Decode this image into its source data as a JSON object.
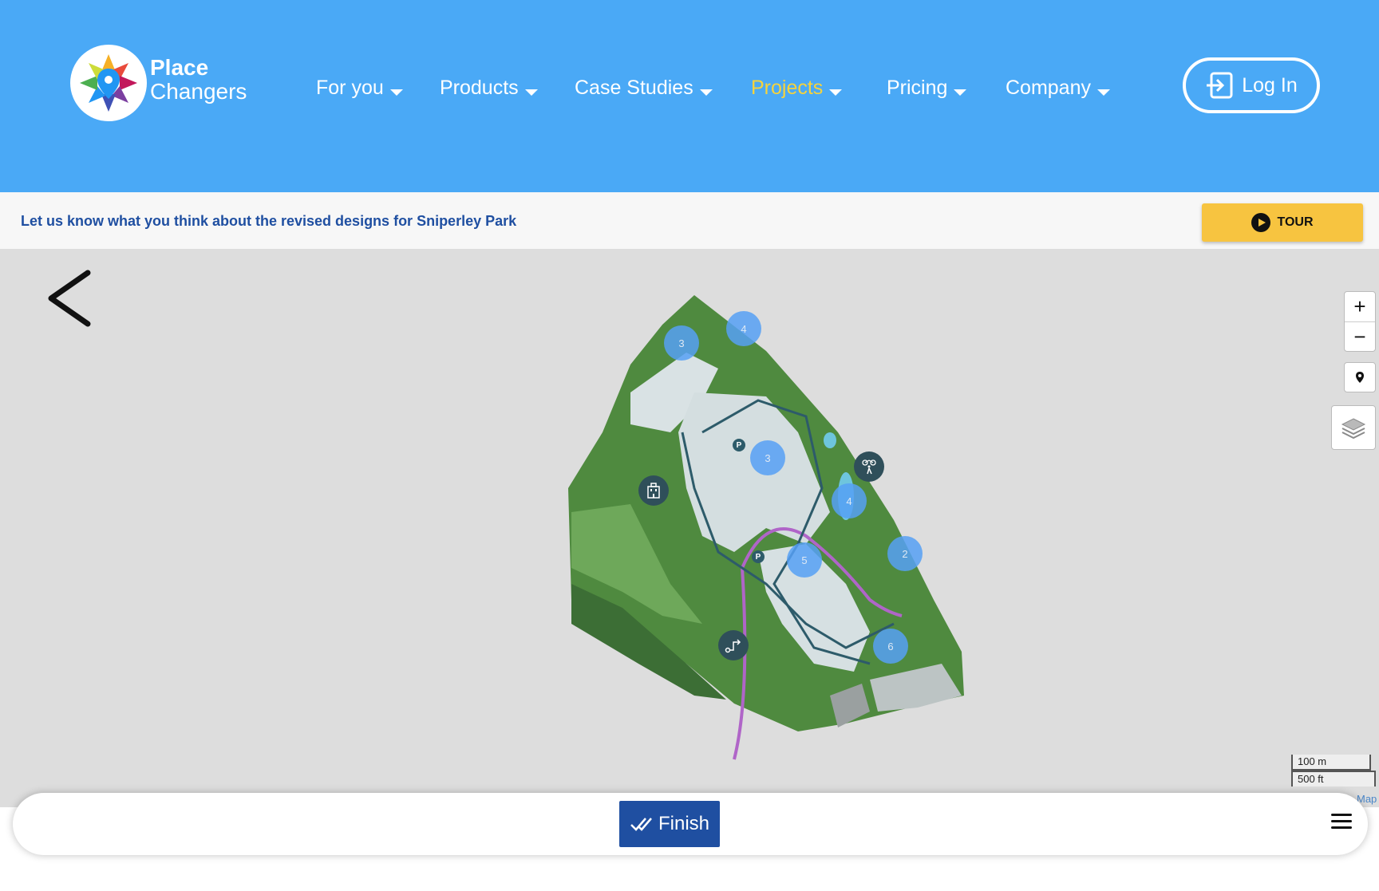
{
  "header": {
    "brand_line1": "Place",
    "brand_line2": "Changers",
    "nav": [
      {
        "label": "For you"
      },
      {
        "label": "Products"
      },
      {
        "label": "Case Studies"
      },
      {
        "label": "Projects",
        "active": true
      },
      {
        "label": "Pricing"
      },
      {
        "label": "Company"
      }
    ],
    "login_label": "Log In"
  },
  "infobar": {
    "message": "Let us know what you think about the revised designs for Sniperley Park",
    "tour_label": "TOUR"
  },
  "map": {
    "markers": [
      {
        "value": "3"
      },
      {
        "value": "4"
      },
      {
        "value": "3"
      },
      {
        "value": "4"
      },
      {
        "value": "2"
      },
      {
        "value": "5"
      },
      {
        "value": "6"
      }
    ],
    "poi_labels": [
      "P",
      "P"
    ],
    "icons": [
      "building-icon",
      "cycle-walk-icon",
      "route-icon"
    ],
    "zoom_in": "+",
    "zoom_out": "−",
    "scale_metric": "100 m",
    "scale_imperial": "500 ft",
    "attribution": "Map"
  },
  "footer": {
    "finish_label": "Finish"
  },
  "colors": {
    "header_bg": "#4aa9f6",
    "accent_yellow": "#f7c440",
    "primary_blue": "#1f4fa1",
    "map_bg": "#dddddd"
  }
}
